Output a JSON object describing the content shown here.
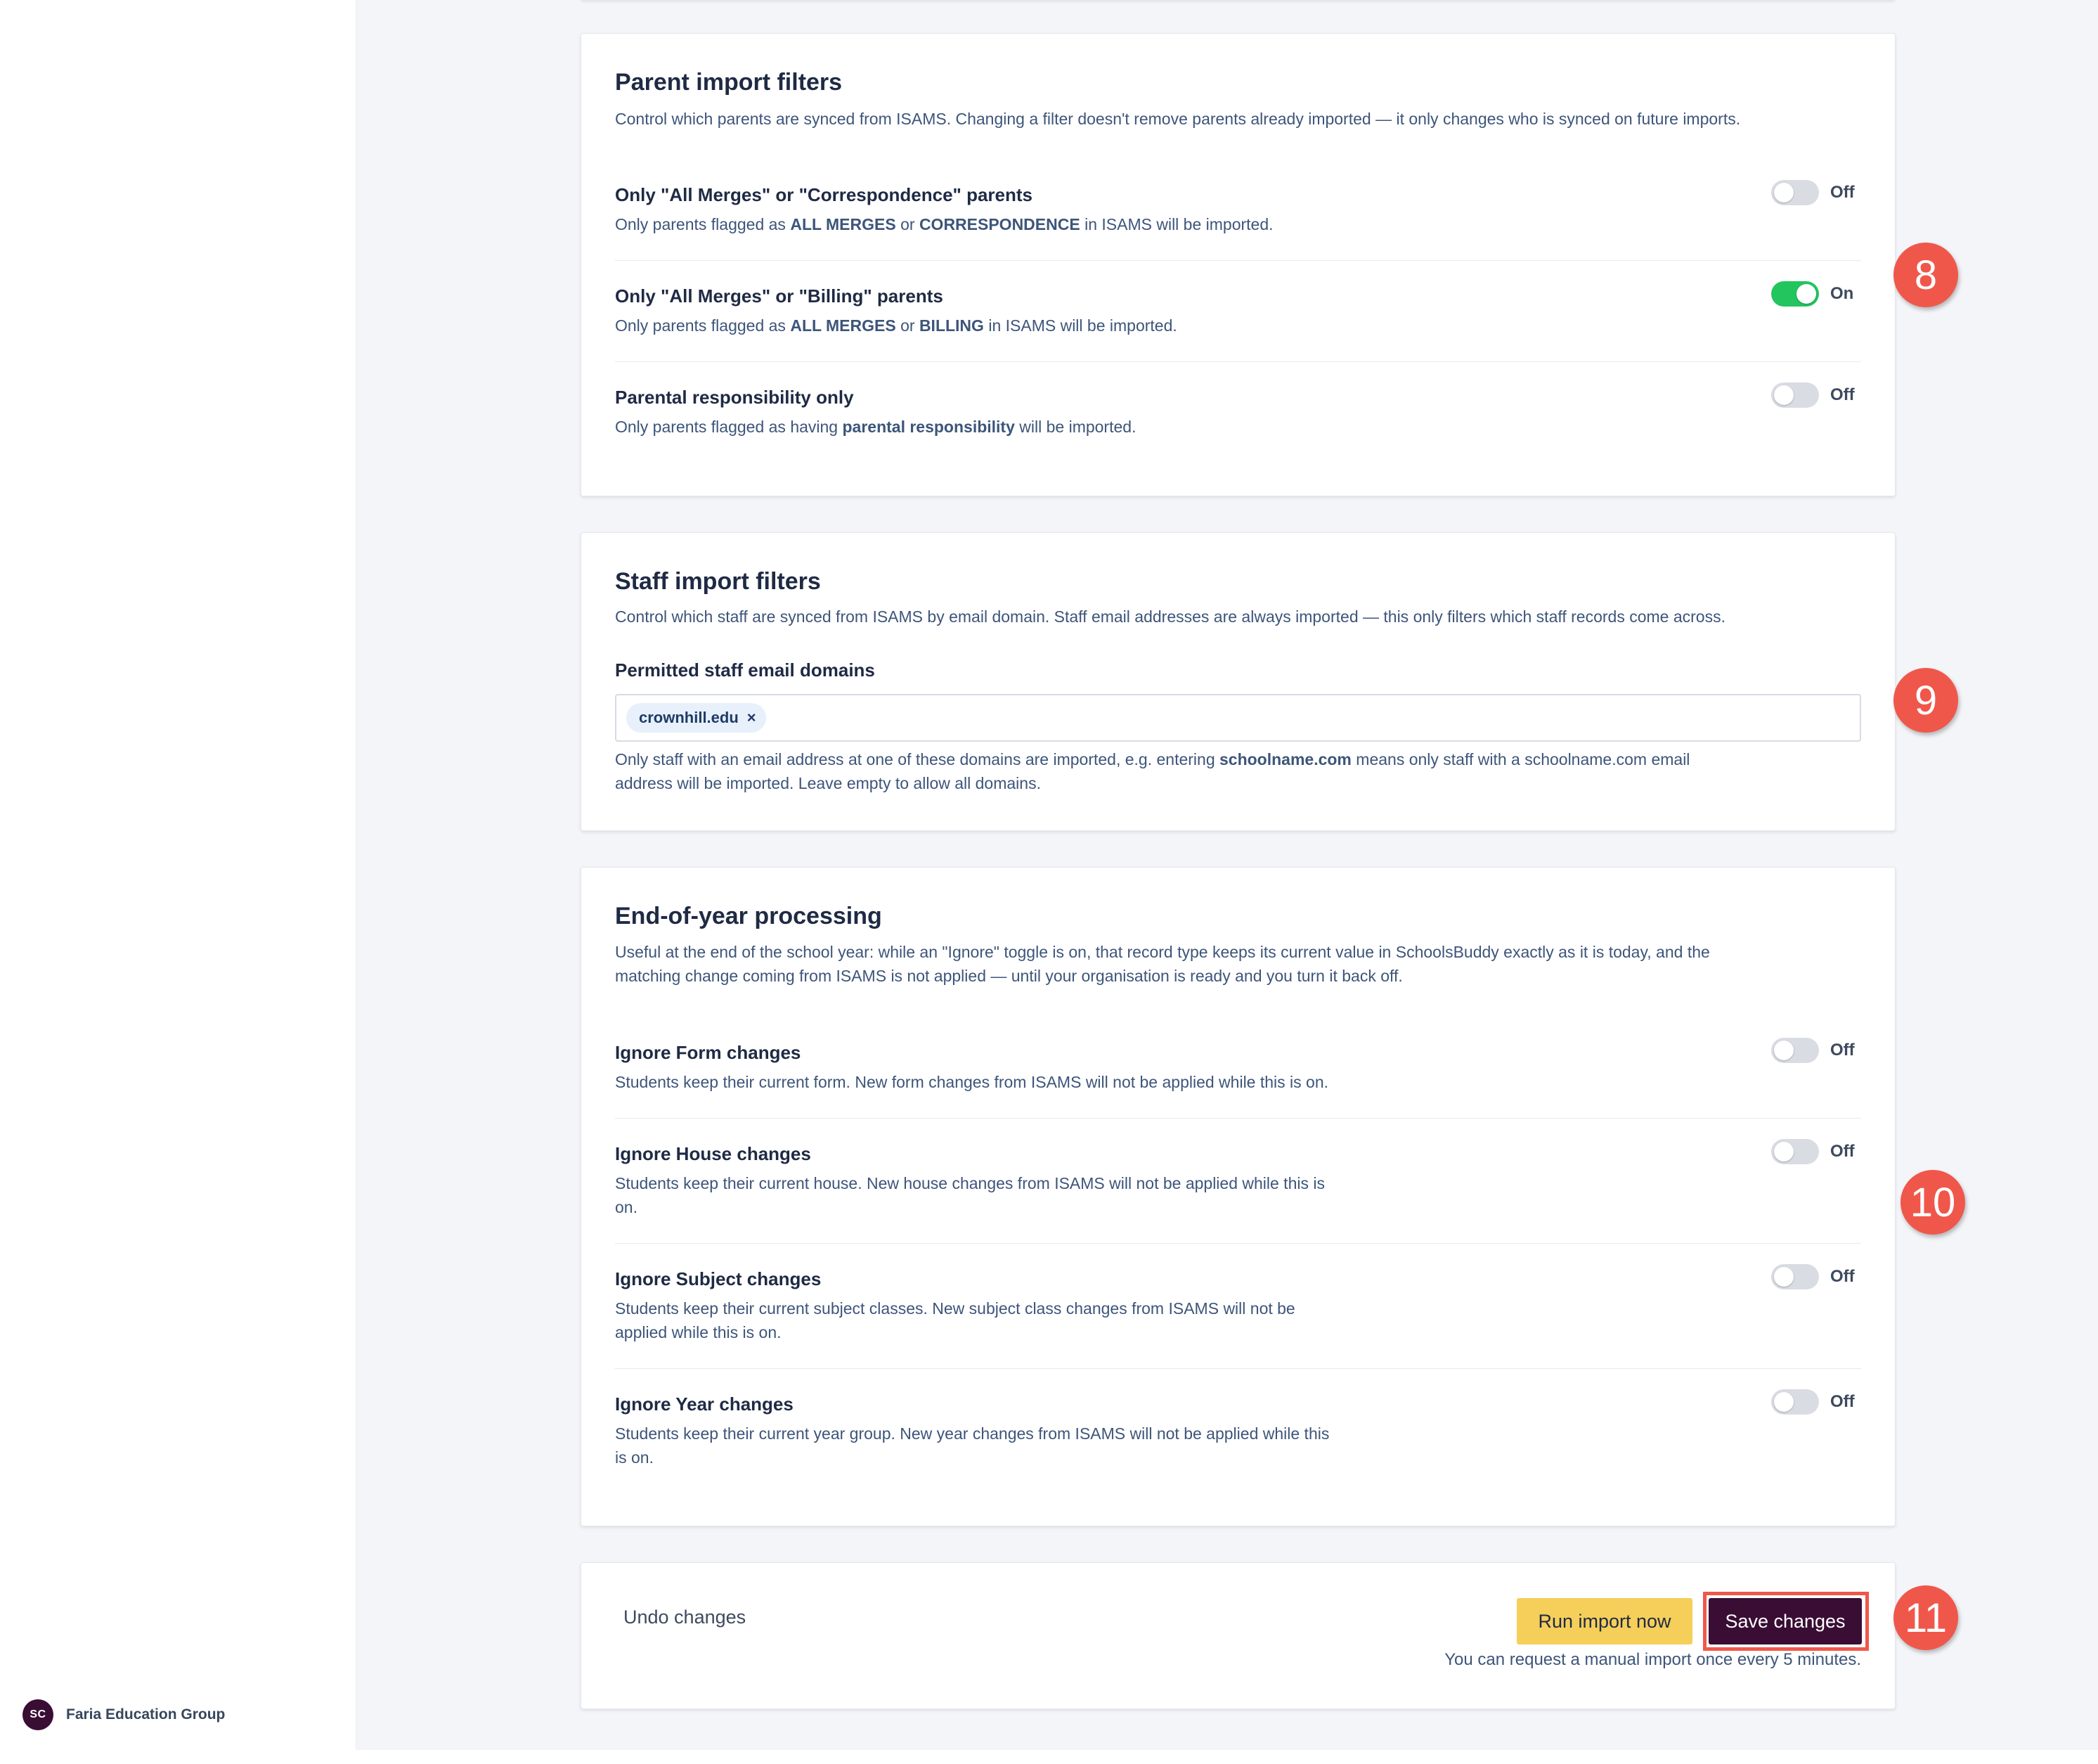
{
  "sidebar": {
    "avatar_initials": "SC",
    "org_name": "Faria Education Group"
  },
  "parent_filters": {
    "title": "Parent import filters",
    "description": "Control which parents are synced from ISAMS. Changing a filter doesn't remove parents already imported — it only changes who is synced on future imports.",
    "items": [
      {
        "label": "Only \"All Merges\" or \"Correspondence\" parents",
        "help_prefix": "Only parents flagged as ",
        "help_b1": "ALL MERGES",
        "help_mid": " or ",
        "help_b2": "CORRESPONDENCE",
        "help_suffix": " in ISAMS will be imported.",
        "state": "Off",
        "on": false
      },
      {
        "label": "Only \"All Merges\" or \"Billing\" parents",
        "help_prefix": "Only parents flagged as ",
        "help_b1": "ALL MERGES",
        "help_mid": " or ",
        "help_b2": "BILLING",
        "help_suffix": " in ISAMS will be imported.",
        "state": "On",
        "on": true
      },
      {
        "label": "Parental responsibility only",
        "help_prefix": "Only parents flagged as having ",
        "help_b1": "parental responsibility",
        "help_suffix": " will be imported.",
        "state": "Off",
        "on": false
      }
    ]
  },
  "staff_filters": {
    "title": "Staff import filters",
    "description": "Control which staff are synced from ISAMS by email domain. Staff email addresses are always imported — this only filters which staff records come across.",
    "field_label": "Permitted staff email domains",
    "tags": [
      "crownhill.edu"
    ],
    "tag_remove_glyph": "×",
    "help_prefix": "Only staff with an email address at one of these domains are imported, e.g. entering ",
    "help_bold": "schoolname.com",
    "help_line1_suffix": " means only staff with a schoolname.com email",
    "help_line2": "address will be imported. Leave empty to allow all domains."
  },
  "end_of_year": {
    "title": "End-of-year processing",
    "description_line1": "Useful at the end of the school year: while an \"Ignore\" toggle is on, that record type keeps its current value in SchoolsBuddy exactly as it is today, and the",
    "description_line2": "matching change coming from ISAMS is not applied — until your organisation is ready and you turn it back off.",
    "items": [
      {
        "label": "Ignore Form changes",
        "help_lines": [
          "Students keep their current form. New form changes from ISAMS will not be applied while this is on."
        ],
        "state": "Off",
        "on": false
      },
      {
        "label": "Ignore House changes",
        "help_lines": [
          "Students keep their current house. New house changes from ISAMS will not be applied while this is",
          "on."
        ],
        "state": "Off",
        "on": false
      },
      {
        "label": "Ignore Subject changes",
        "help_lines": [
          "Students keep their current subject classes. New subject class changes from ISAMS will not be",
          "applied while this is on."
        ],
        "state": "Off",
        "on": false
      },
      {
        "label": "Ignore Year changes",
        "help_lines": [
          "Students keep their current year group. New year changes from ISAMS will not be applied while this",
          "is on."
        ],
        "state": "Off",
        "on": false
      }
    ]
  },
  "actions": {
    "undo_label": "Undo changes",
    "run_label": "Run import now",
    "save_label": "Save changes",
    "note": "You can request a manual import once every 5 minutes."
  },
  "annotations": [
    "8",
    "9",
    "10",
    "11"
  ],
  "colors": {
    "toggle_on": "#22c55e",
    "toggle_off": "#d9dce3",
    "badge": "#f0574b",
    "save_button": "#3a0d35",
    "run_button": "#f5cf5a"
  }
}
